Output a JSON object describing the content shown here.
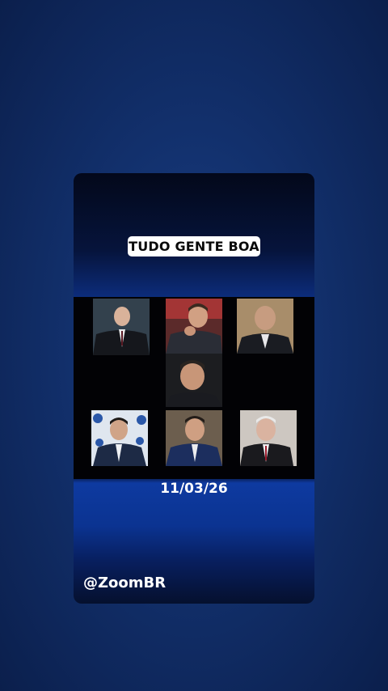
{
  "title": "TUDO GENTE BOA",
  "date": "11/03/26",
  "handle": "@ZoomBR"
}
